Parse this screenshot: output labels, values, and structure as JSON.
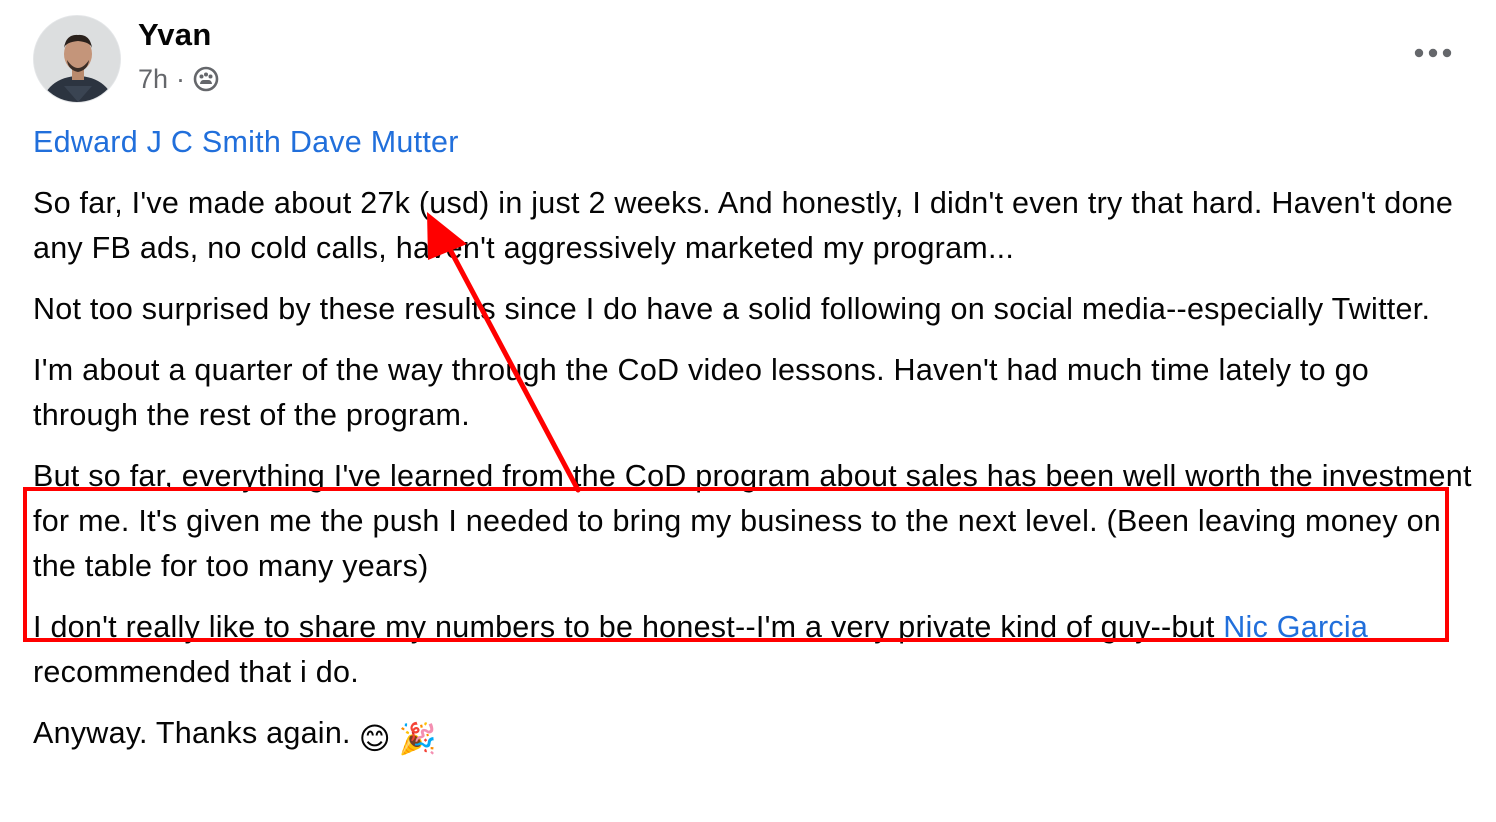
{
  "post": {
    "author_name": "Yvan",
    "timestamp": "7h",
    "separator": "·",
    "audience_icon": "group-icon",
    "more_icon": "more-horizontal-icon",
    "mentions": {
      "first": "Edward J C Smith",
      "second": "Dave Mutter"
    },
    "paragraphs": {
      "p1": "So far, I've made about 27k (usd) in just 2 weeks. And honestly, I didn't even try that hard. Haven't done any FB ads, no cold calls, haven't aggressively marketed my program...",
      "p2": "Not too surprised by these results since I do have a solid following on social media--especially Twitter.",
      "p3": "I'm about a quarter of the way through the CoD video lessons. Haven't had much time lately to go through the rest of the program.",
      "p4": "But so far, everything I've learned from the CoD program about sales has been well worth the investment for me. It's given me the push I needed to bring my business to the next level. (Been leaving money on the table for too many years)",
      "p5_before": "I don't really like to share my numbers to be honest--I'm a very private kind of guy--but ",
      "p5_mention": "Nic Garcia",
      "p5_after": " recommended that i do.",
      "p6": "Anyway. Thanks again."
    },
    "emojis": [
      "😊",
      "🎉"
    ]
  },
  "annotations": {
    "box_color": "#ff0000",
    "arrow_color": "#ff0000"
  },
  "colors": {
    "link": "#216fdb",
    "text": "#050505",
    "secondary": "#65676b"
  }
}
